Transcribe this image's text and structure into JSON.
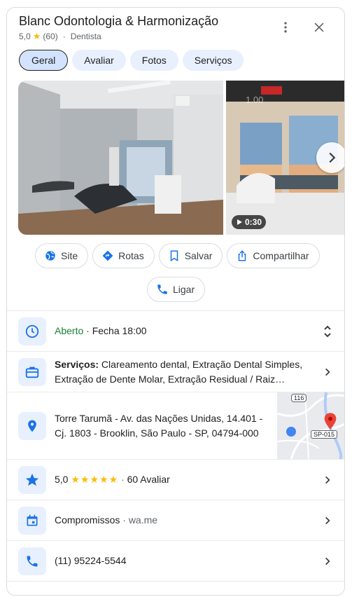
{
  "header": {
    "title": "Blanc Odontologia & Harmonização",
    "rating": "5,0",
    "review_count": "(60)",
    "category": "Dentista"
  },
  "tabs": [
    {
      "label": "Geral",
      "active": true
    },
    {
      "label": "Avaliar",
      "active": false
    },
    {
      "label": "Fotos",
      "active": false
    },
    {
      "label": "Serviços",
      "active": false
    }
  ],
  "photos": {
    "video_duration": "0:30",
    "side_watermark": "1.00"
  },
  "actions": [
    {
      "label": "Site",
      "icon": "globe-icon"
    },
    {
      "label": "Rotas",
      "icon": "directions-icon"
    },
    {
      "label": "Salvar",
      "icon": "bookmark-icon"
    },
    {
      "label": "Compartilhar",
      "icon": "share-icon"
    },
    {
      "label": "Ligar",
      "icon": "phone-icon"
    }
  ],
  "hours": {
    "status": "Aberto",
    "separator": " · ",
    "closing": "Fecha 18:00"
  },
  "services": {
    "label": "Serviços:",
    "text": " Clareamento dental, Extração Dental Simples, Extração de Dente Molar, Extração Residual / Raiz…"
  },
  "address": {
    "line1": "Torre Tarumã - Av. das Nações Unidas, 14.401 -",
    "line2": "Cj. 1803 - Brooklin, São Paulo - SP, 04794-000",
    "map_route_1": "116",
    "map_route_2": "SP-015"
  },
  "reviews": {
    "rating": "5,0",
    "stars": "★★★★★",
    "count": "60 Avaliar"
  },
  "appointments": {
    "label": "Compromissos",
    "link": "wa.me"
  },
  "phone": {
    "number": "(11) 95224-5544"
  },
  "colors": {
    "accent_blue": "#1a73e8",
    "open_green": "#188038",
    "star_yellow": "#fbbc04",
    "pin_red": "#ea4335"
  }
}
